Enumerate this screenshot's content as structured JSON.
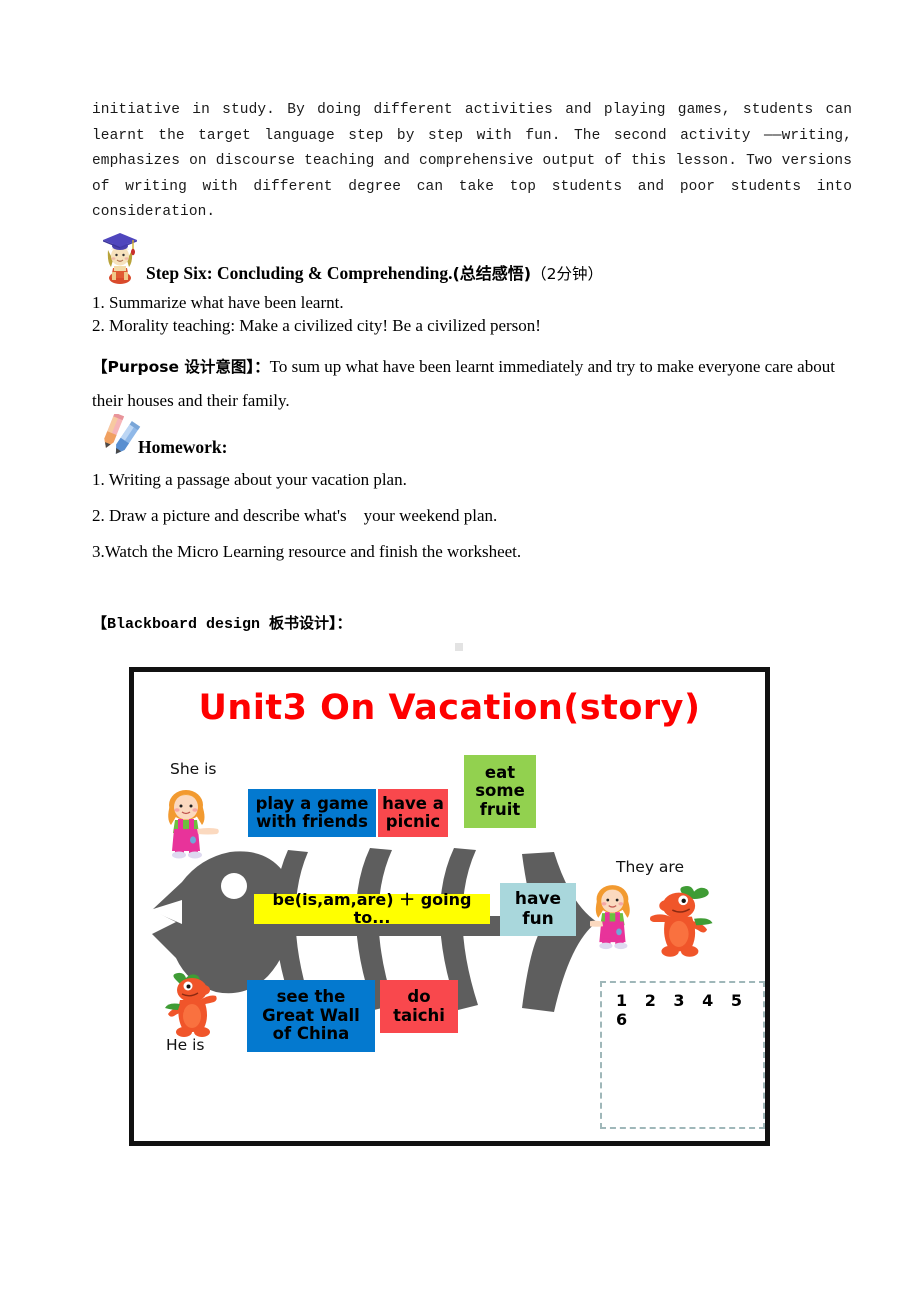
{
  "document": {
    "top_paragraph": "initiative in study. By doing different activities and playing games, students can learnt the target language step by step with fun. The second activity ——writing, emphasizes on discourse teaching and  comprehensive output of this lesson. Two versions of writing with different degree can take top students and poor students into consideration."
  },
  "step_six": {
    "icon": "graduate-student-icon",
    "heading_en": "Step Six: Concluding & Comprehending.",
    "heading_cn": "(总结感悟)",
    "heading_time": "（2分钟）",
    "items": [
      "1. Summarize what have been learnt.",
      "2. Morality teaching: Make a civilized city! Be a civilized person!"
    ]
  },
  "purpose": {
    "tag": "【Purpose 设计意图】：",
    "text": "To sum up what have been learnt immediately and try to make everyone care about their houses and their family."
  },
  "homework": {
    "icon": "colored-pencils-icon",
    "title": "Homework:",
    "items": [
      "1. Writing a passage about your vacation plan.",
      "2. Draw a picture and describe what's    your weekend plan.",
      "3.Watch the Micro Learning resource and finish the worksheet."
    ]
  },
  "blackboard": {
    "label_en": "【Blackboard design ",
    "label_cn": "板书设计",
    "label_end": "】：",
    "title": "Unit3 On Vacation(story)",
    "labels": {
      "she_is": "She is",
      "he_is": "He is",
      "they_are": "They are"
    },
    "cards": {
      "play_game": "play a game\nwith friends",
      "picnic": "have a\npicnic",
      "fruit": "eat\nsome\nfruit",
      "structure": "be(is,am,are) ＋ going to...",
      "fun": "have\nfun",
      "great_wall": "see the\nGreat Wall\nof China",
      "taichi": "do\ntaichi"
    },
    "numbers_box": "1 2 3 4 5 6",
    "colors": {
      "title_red": "#fe0000",
      "card_blue": "#0479cf",
      "card_red": "#f9484d",
      "card_green": "#92d14f",
      "card_yellow": "#ffff00",
      "card_cyan": "#a9d7dc",
      "fishbone_gray": "#5e5e5e",
      "frame_black": "#111111",
      "dash_border": "#9fb7b9"
    }
  }
}
